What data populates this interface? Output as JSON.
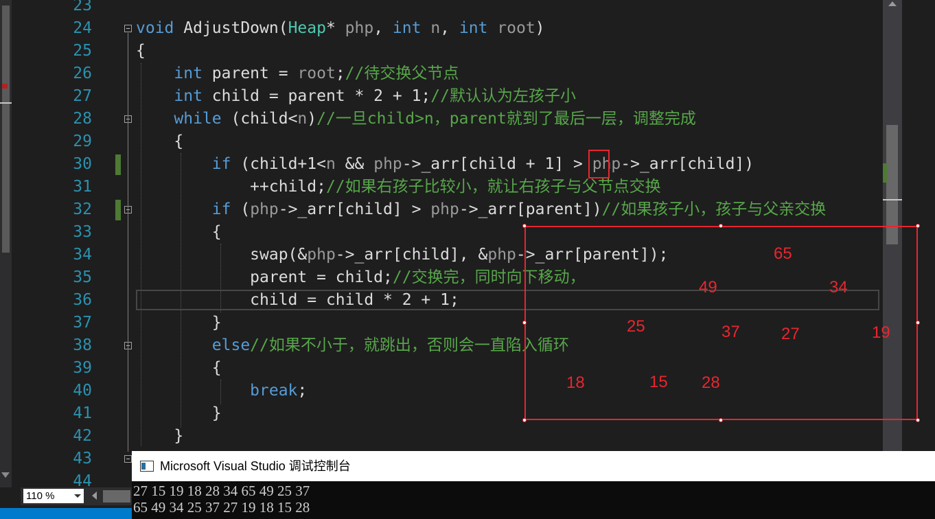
{
  "editor": {
    "lines": [
      {
        "num": "23",
        "tokens": []
      },
      {
        "num": "24",
        "tokens": [
          {
            "t": "void",
            "c": "kw"
          },
          {
            "t": " AdjustDown(",
            "c": ""
          },
          {
            "t": "Heap",
            "c": "ty"
          },
          {
            "t": "* ",
            "c": ""
          },
          {
            "t": "php",
            "c": "pm"
          },
          {
            "t": ", ",
            "c": ""
          },
          {
            "t": "int",
            "c": "kw"
          },
          {
            "t": " ",
            "c": ""
          },
          {
            "t": "n",
            "c": "pm"
          },
          {
            "t": ", ",
            "c": ""
          },
          {
            "t": "int",
            "c": "kw"
          },
          {
            "t": " ",
            "c": ""
          },
          {
            "t": "root",
            "c": "pm"
          },
          {
            "t": ")",
            "c": ""
          }
        ]
      },
      {
        "num": "25",
        "tokens": [
          {
            "t": "{",
            "c": ""
          }
        ]
      },
      {
        "num": "26",
        "tokens": [
          {
            "t": "    ",
            "c": ""
          },
          {
            "t": "int",
            "c": "kw"
          },
          {
            "t": " parent = ",
            "c": ""
          },
          {
            "t": "root",
            "c": "pm"
          },
          {
            "t": ";",
            "c": ""
          },
          {
            "t": "//待交换父节点",
            "c": "cm"
          }
        ]
      },
      {
        "num": "27",
        "tokens": [
          {
            "t": "    ",
            "c": ""
          },
          {
            "t": "int",
            "c": "kw"
          },
          {
            "t": " child = parent * 2 + 1;",
            "c": ""
          },
          {
            "t": "//默认认为左孩子小",
            "c": "cm"
          }
        ]
      },
      {
        "num": "28",
        "tokens": [
          {
            "t": "    ",
            "c": ""
          },
          {
            "t": "while",
            "c": "kw"
          },
          {
            "t": " (child<",
            "c": ""
          },
          {
            "t": "n",
            "c": "pm"
          },
          {
            "t": ")",
            "c": ""
          },
          {
            "t": "//一旦child>n，parent就到了最后一层，调整完成",
            "c": "cm"
          }
        ]
      },
      {
        "num": "29",
        "tokens": [
          {
            "t": "    {",
            "c": ""
          }
        ]
      },
      {
        "num": "30",
        "tokens": [
          {
            "t": "        ",
            "c": ""
          },
          {
            "t": "if",
            "c": "kw"
          },
          {
            "t": " (child+1<",
            "c": ""
          },
          {
            "t": "n",
            "c": "pm"
          },
          {
            "t": " && ",
            "c": ""
          },
          {
            "t": "php",
            "c": "pm"
          },
          {
            "t": "->_arr[child + 1] > ",
            "c": ""
          },
          {
            "t": "php",
            "c": "pm"
          },
          {
            "t": "->_arr[child])",
            "c": ""
          }
        ]
      },
      {
        "num": "31",
        "tokens": [
          {
            "t": "            ++child;",
            "c": ""
          },
          {
            "t": "//如果右孩子比较小，就让右孩子与父节点交换",
            "c": "cm"
          }
        ]
      },
      {
        "num": "32",
        "tokens": [
          {
            "t": "        ",
            "c": ""
          },
          {
            "t": "if",
            "c": "kw"
          },
          {
            "t": " (",
            "c": ""
          },
          {
            "t": "php",
            "c": "pm"
          },
          {
            "t": "->_arr[child] > ",
            "c": ""
          },
          {
            "t": "php",
            "c": "pm"
          },
          {
            "t": "->_arr[parent])",
            "c": ""
          },
          {
            "t": "//如果孩子小，孩子与父亲交换",
            "c": "cm"
          }
        ]
      },
      {
        "num": "33",
        "tokens": [
          {
            "t": "        {",
            "c": ""
          }
        ]
      },
      {
        "num": "34",
        "tokens": [
          {
            "t": "            swap(&",
            "c": ""
          },
          {
            "t": "php",
            "c": "pm"
          },
          {
            "t": "->_arr[child], &",
            "c": ""
          },
          {
            "t": "php",
            "c": "pm"
          },
          {
            "t": "->_arr[parent]);",
            "c": ""
          }
        ]
      },
      {
        "num": "35",
        "tokens": [
          {
            "t": "            parent = child;",
            "c": ""
          },
          {
            "t": "//交换完，同时向下移动，",
            "c": "cm"
          }
        ]
      },
      {
        "num": "36",
        "tokens": [
          {
            "t": "            child = child * 2 + 1;",
            "c": ""
          }
        ]
      },
      {
        "num": "37",
        "tokens": [
          {
            "t": "        }",
            "c": ""
          }
        ]
      },
      {
        "num": "38",
        "tokens": [
          {
            "t": "        ",
            "c": ""
          },
          {
            "t": "else",
            "c": "kw"
          },
          {
            "t": "//如果不小于，就跳出，否则会一直陷入循环",
            "c": "cm"
          }
        ]
      },
      {
        "num": "39",
        "tokens": [
          {
            "t": "        {",
            "c": ""
          }
        ]
      },
      {
        "num": "40",
        "tokens": [
          {
            "t": "            ",
            "c": ""
          },
          {
            "t": "break",
            "c": "kw"
          },
          {
            "t": ";",
            "c": ""
          }
        ]
      },
      {
        "num": "41",
        "tokens": [
          {
            "t": "        }",
            "c": ""
          }
        ]
      },
      {
        "num": "42",
        "tokens": [
          {
            "t": "    }",
            "c": ""
          }
        ]
      },
      {
        "num": "43",
        "tokens": []
      },
      {
        "num": "44",
        "tokens": []
      }
    ],
    "colors": {
      "keyword": "#569cd6",
      "type": "#4ec9b0",
      "param": "#9a9a9a",
      "comment": "#57a64a",
      "line_number": "#2b91af",
      "annotation": "#e8262f"
    }
  },
  "zoom": {
    "value": "110 %"
  },
  "console": {
    "title": "Microsoft Visual Studio 调试控制台",
    "lines": [
      "27 15 19 18 28 34 65 49 25 37",
      "65 49 34 25 37 27 19 18 15 28"
    ]
  },
  "annotation": {
    "heap_numbers": [
      "65",
      "49",
      "34",
      "25",
      "37",
      "27",
      "19",
      "18",
      "15",
      "28"
    ]
  }
}
